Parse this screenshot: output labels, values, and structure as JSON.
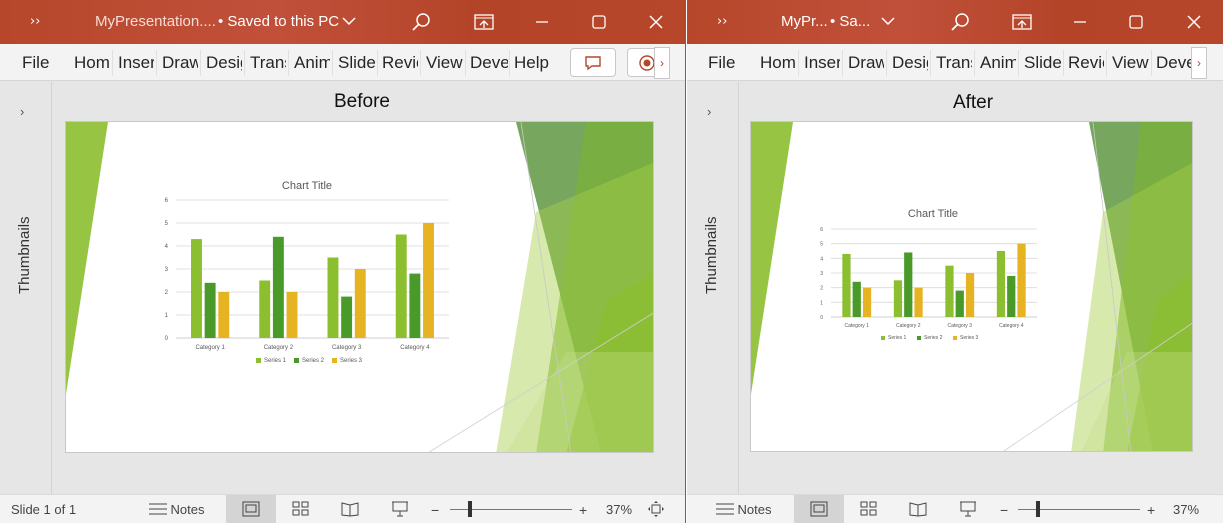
{
  "left_window": {
    "title_filename": "MyPresentation....",
    "title_status": "• Saved to this PC",
    "tabs": [
      "File",
      "Hom",
      "Inser",
      "Draw",
      "Desig",
      "Trans",
      "Anim",
      "Slide",
      "Revie",
      "View",
      "Deve",
      "Help"
    ],
    "thumbnails_label": "Thumbnails",
    "heading": "Before",
    "chart_title": "Chart Title",
    "status_slide": "Slide 1 of 1",
    "notes_label": "Notes",
    "zoom": "37%"
  },
  "right_window": {
    "title_filename": "MyPr...",
    "title_status": "• Sa...",
    "tabs": [
      "File",
      "Hom",
      "Inser",
      "Draw",
      "Desig",
      "Trans",
      "Anim",
      "Slide",
      "Revie",
      "View",
      "Deve"
    ],
    "thumbnails_label": "Thumbnails",
    "heading": "After",
    "chart_title": "Chart Title",
    "notes_label": "Notes",
    "zoom": "37%"
  },
  "icons": {
    "qat": "quick-access-chevrons-icon",
    "dropdown": "chevron-down-icon",
    "search": "search-icon",
    "ribbon_display": "ribbon-display-options-icon",
    "minimize": "minimize-icon",
    "maximize": "maximize-icon",
    "close": "close-icon",
    "comments": "comments-icon",
    "record": "record-icon",
    "normal_view": "normal-view-icon",
    "sorter_view": "slide-sorter-icon",
    "reading_view": "reading-view-icon",
    "slideshow": "slideshow-icon",
    "fit": "fit-slide-icon"
  },
  "colors": {
    "titlebar": "#b7472a",
    "series1": "#8cbf2f",
    "series2": "#4a9a2a",
    "series3": "#e6b422"
  },
  "chart_data": {
    "type": "bar",
    "title": "Chart Title",
    "categories": [
      "Category 1",
      "Category 2",
      "Category 3",
      "Category 4"
    ],
    "series": [
      {
        "name": "Series 1",
        "values": [
          4.3,
          2.5,
          3.5,
          4.5
        ]
      },
      {
        "name": "Series 2",
        "values": [
          2.4,
          4.4,
          1.8,
          2.8
        ]
      },
      {
        "name": "Series 3",
        "values": [
          2,
          2,
          3,
          5
        ]
      }
    ],
    "ylim": [
      0,
      6
    ],
    "yticks": [
      "0",
      "1",
      "2",
      "3",
      "4",
      "5",
      "6"
    ],
    "grid": true,
    "legend": "bottom"
  }
}
